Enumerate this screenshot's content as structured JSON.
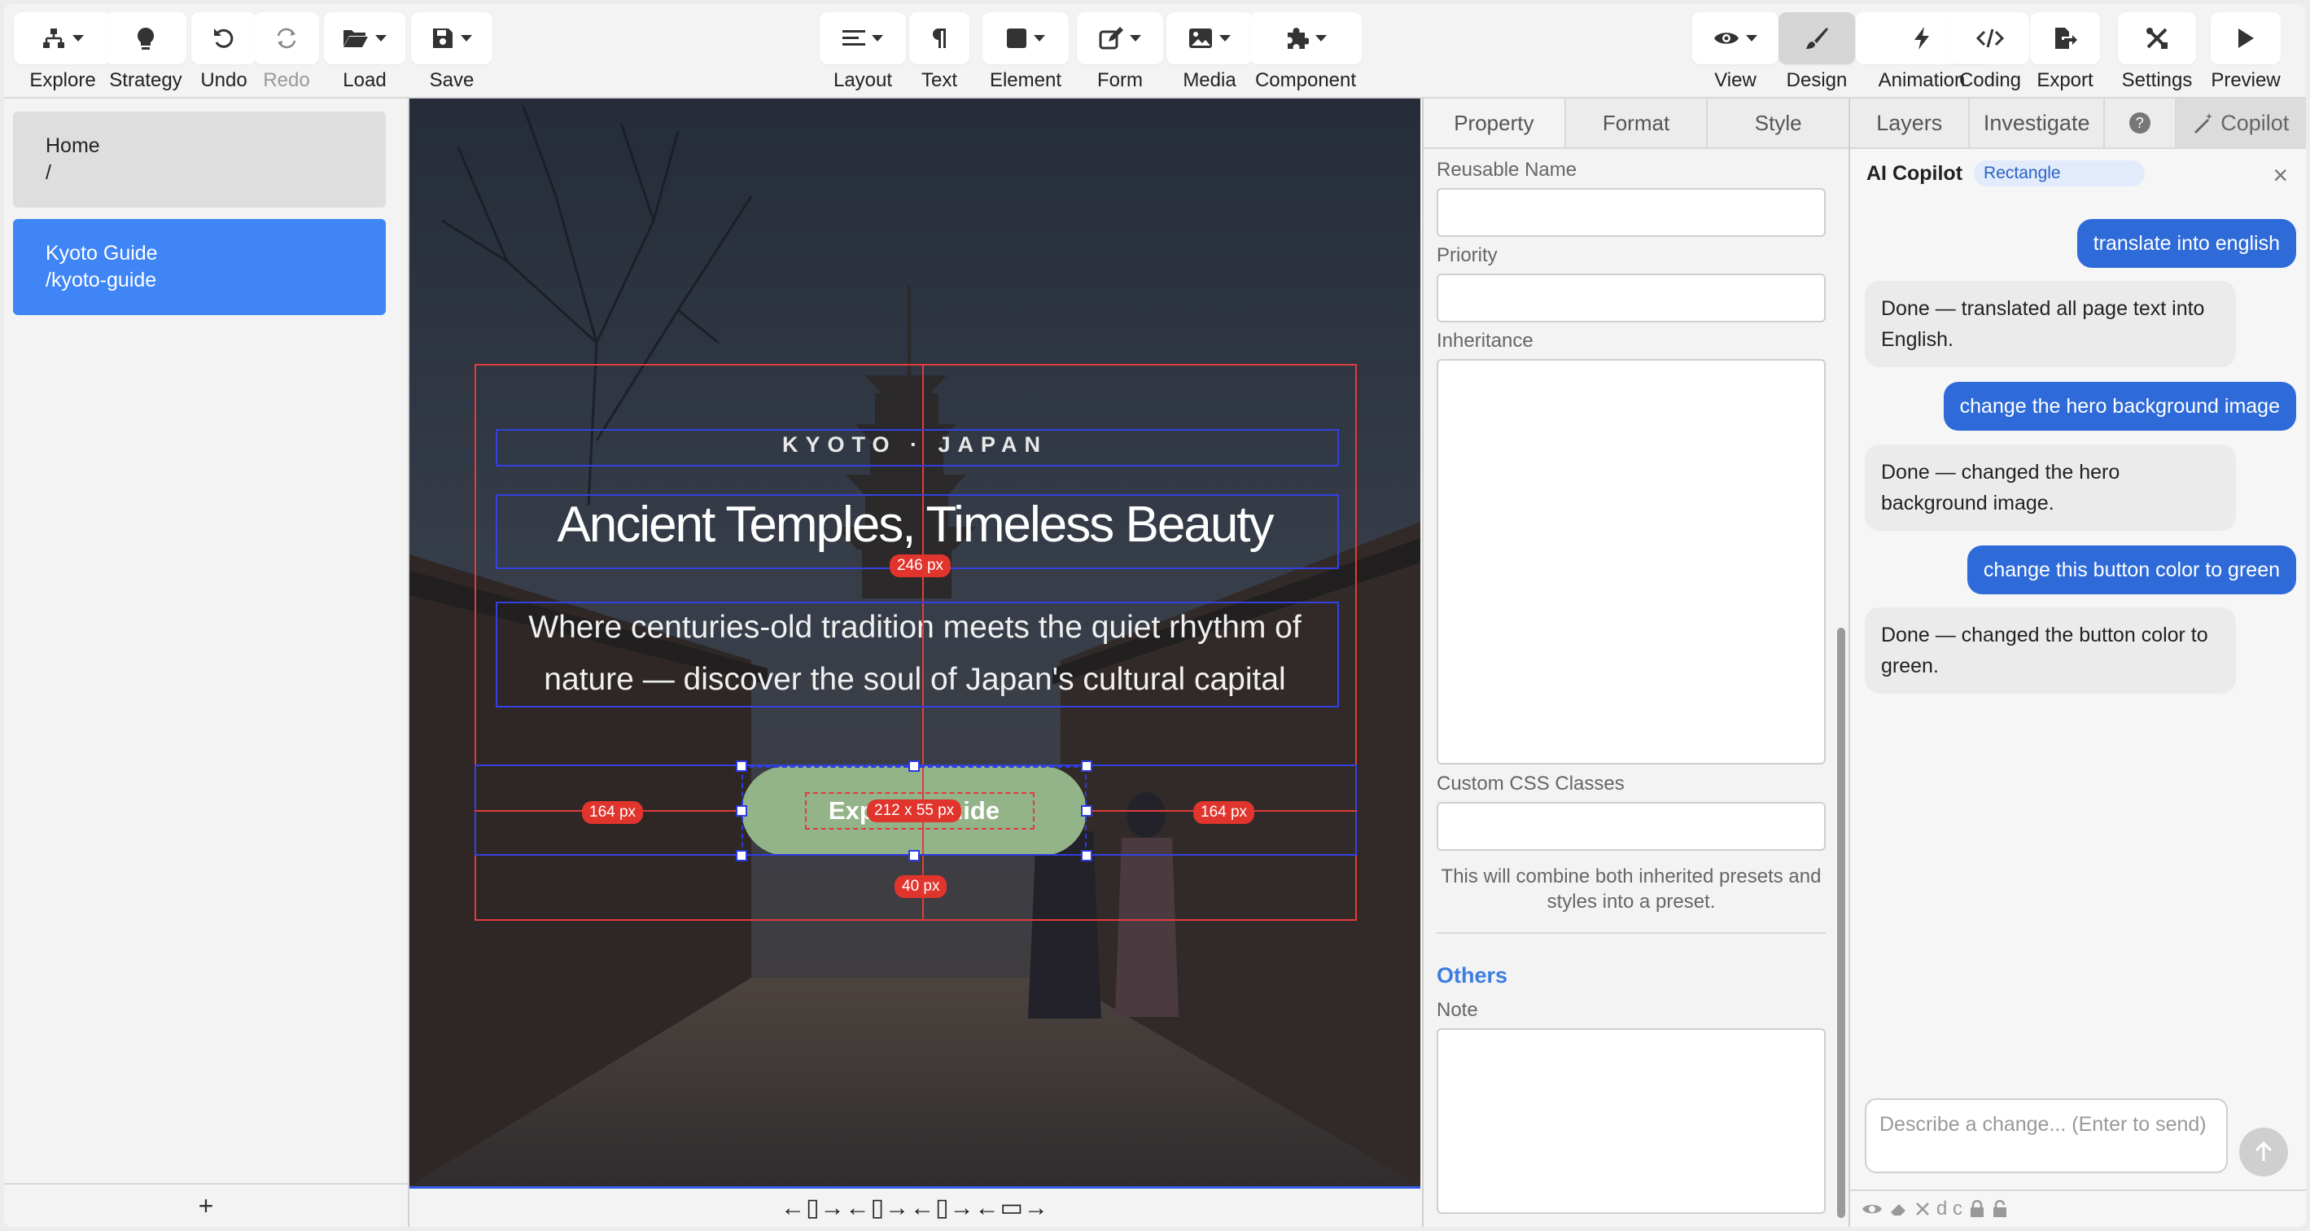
{
  "toolbar": {
    "left": [
      {
        "label": "Explore",
        "icon": "sitemap-icon"
      },
      {
        "label": "Strategy",
        "icon": "lightbulb-icon"
      },
      {
        "label": "Undo",
        "icon": "undo-icon"
      },
      {
        "label": "Redo",
        "icon": "redo-icon"
      },
      {
        "label": "Load",
        "icon": "folder-icon"
      },
      {
        "label": "Save",
        "icon": "save-icon"
      }
    ],
    "center": [
      {
        "label": "Layout",
        "icon": "layout-icon"
      },
      {
        "label": "Text",
        "icon": "pilcrow-icon"
      },
      {
        "label": "Element",
        "icon": "square-icon"
      },
      {
        "label": "Form",
        "icon": "edit-icon"
      },
      {
        "label": "Media",
        "icon": "image-icon"
      },
      {
        "label": "Component",
        "icon": "puzzle-icon"
      }
    ],
    "right": [
      {
        "label": "View",
        "icon": "eye-icon"
      },
      {
        "label": "Design",
        "icon": "brush-icon"
      },
      {
        "label": "Animation",
        "icon": "bolt-icon"
      },
      {
        "label": "Coding",
        "icon": "code-icon"
      },
      {
        "label": "Export",
        "icon": "export-icon"
      },
      {
        "label": "Settings",
        "icon": "tools-icon"
      },
      {
        "label": "Preview",
        "icon": "play-icon"
      }
    ]
  },
  "pages": {
    "items": [
      {
        "name": "Home",
        "path": "/"
      },
      {
        "name": "Kyoto Guide",
        "path": "/kyoto-guide"
      }
    ],
    "add_label": "+"
  },
  "canvas": {
    "eyebrow": "KYOTO · JAPAN",
    "headline": "Ancient Temples, Timeless Beauty",
    "subtitle": "Where centuries-old tradition meets the quiet rhythm of nature — discover the soul of Japan's cultural capital",
    "cta_label": "Explore Guide",
    "button_color": "#93b388",
    "measures": {
      "top": "246 px",
      "left": "164 px",
      "right": "164 px",
      "size": "212 x 55 px",
      "bottom": "40 px"
    },
    "device_bar": "←▯→←▯→←▯→←▭→"
  },
  "property_panel": {
    "tabs": [
      "Property",
      "Format",
      "Style"
    ],
    "active_tab": "Property",
    "reusable_name_label": "Reusable Name",
    "priority_label": "Priority",
    "inheritance_label": "Inheritance",
    "custom_css_label": "Custom CSS Classes",
    "hint": "This will combine both inherited presets and styles into a preset.",
    "others_heading": "Others",
    "note_label": "Note"
  },
  "copilot": {
    "tabs": [
      "Layers",
      "Investigate",
      "?",
      "Copilot"
    ],
    "title": "AI Copilot",
    "badge": "Rectangle",
    "messages": [
      {
        "role": "user",
        "text": "translate into english"
      },
      {
        "role": "assistant",
        "text": "Done — translated all page text into English."
      },
      {
        "role": "user",
        "text": "change the hero background image"
      },
      {
        "role": "assistant",
        "text": "Done — changed the hero background image."
      },
      {
        "role": "user",
        "text": "change this button color to green"
      },
      {
        "role": "assistant",
        "text": "Done — changed the button color to green."
      }
    ],
    "input_placeholder": "Describe a change... (Enter to send)",
    "footer_text": "d c",
    "accent": "#2e6bd9"
  }
}
